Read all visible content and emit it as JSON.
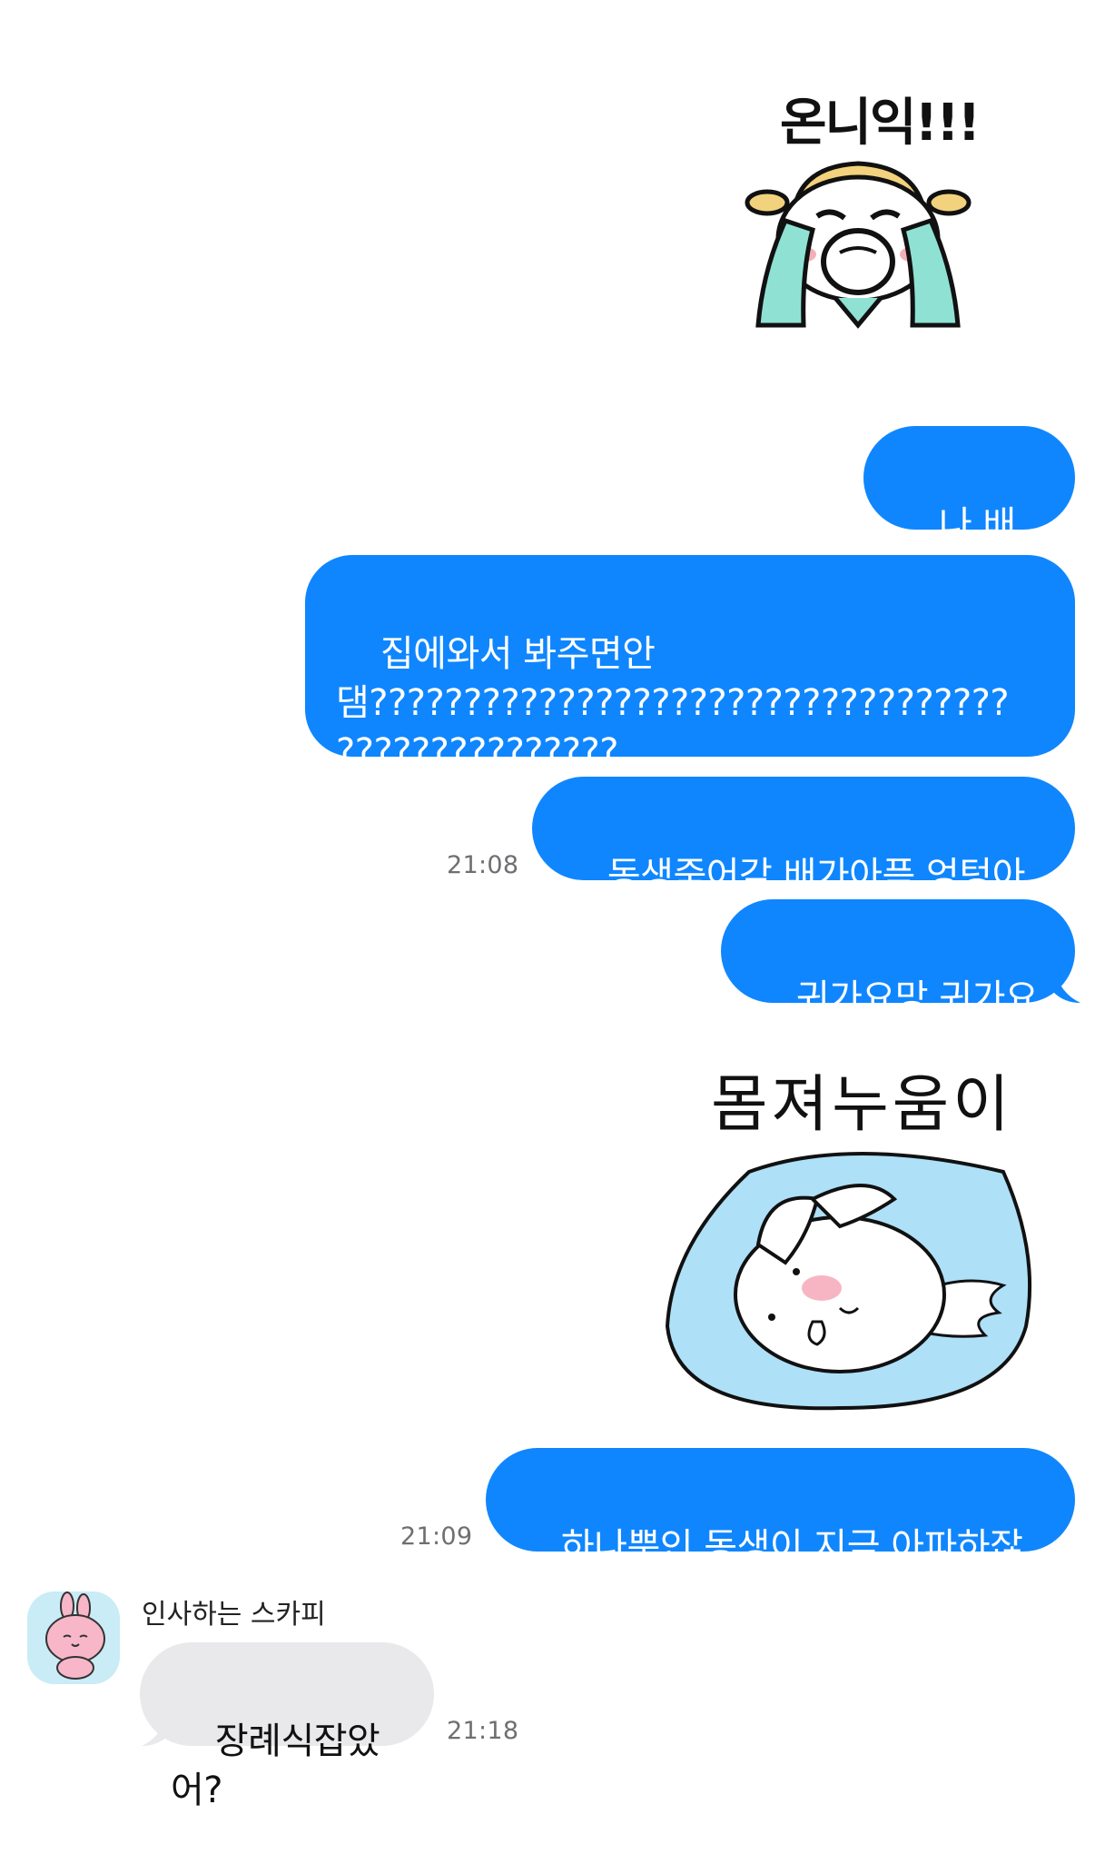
{
  "stickers": [
    {
      "caption": "온니익!!!",
      "name": "crying-girl-sticker"
    },
    {
      "caption": "몸져누움이",
      "name": "lying-down-bunny-sticker"
    }
  ],
  "messages": {
    "m1": "나 배아퍼",
    "m2": "집에와서 봐주면안\n댐??????????????????????????????????\n???????????????",
    "m3": "동생죽어감 배가아픔 엉텅아픔",
    "m4": "귀가요망 귀가요망",
    "m5": "하나뿐인 동생이 지금 아파하잖아",
    "m6": "장례식잡았어?"
  },
  "times": {
    "t1": "21:08",
    "t2": "21:09",
    "t3": "21:18"
  },
  "sender": {
    "name": "인사하는 스카피",
    "avatar_icon": "bunny-avatar-icon"
  },
  "colors": {
    "outgoing_bubble": "#0f86fe",
    "incoming_bubble": "#e9e9eb",
    "timestamp": "#6f6f73"
  }
}
